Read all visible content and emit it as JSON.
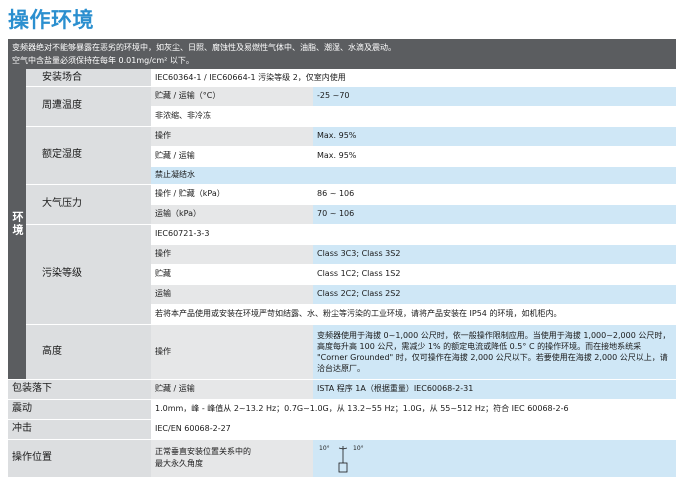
{
  "page": {
    "title": "操作环境",
    "intro_line1": "变频器绝对不能够暴露在恶劣的环境中，如灰尘、日照、腐蚀性及易燃性气体中、油脂、潮湿、水滴及震动。",
    "intro_line2": "空气中含盐量必须保持在每年 0.01mg/cm² 以下。"
  },
  "env_label": "环境",
  "rows": {
    "install_site": {
      "label": "安装场合",
      "value": "IEC60364-1 / IEC60664-1 污染等级 2，仅室内使用"
    },
    "ambient_temp": {
      "label": "周遭温度",
      "storage_transport": "贮藏 / 运输（°C）",
      "storage_value": "-25 ~70",
      "note": "非浓缩、非冷冻"
    },
    "rated_humidity": {
      "label": "额定湿度",
      "operation": "操作",
      "operation_value": "Max. 95%",
      "storage_transport": "贮藏 / 运输",
      "storage_value": "Max. 95%",
      "note": "禁止凝结水"
    },
    "pressure": {
      "label": "大气压力",
      "op_storage": "操作 / 贮藏（kPa）",
      "op_storage_value": "86 ~ 106",
      "transport": "运输（kPa）",
      "transport_value": "70 ~ 106"
    },
    "pollution": {
      "label": "污染等级",
      "standard": "IEC60721-3-3",
      "operation": "操作",
      "operation_value": "Class 3C3; Class 3S2",
      "storage": "贮藏",
      "storage_value": "Class 1C2; Class 1S2",
      "transport": "运输",
      "transport_value": "Class 2C2; Class 2S2",
      "note": "若将本产品使用或安装在环境严苛如结露、水、粉尘等污染的工业环境，请将产品安装在 IP54 的环境，如机柜内。"
    },
    "altitude": {
      "label": "高度",
      "operation": "操作",
      "value": "变频器使用于海拔 0~1,000 公尺时，依一般操作限制应用。当使用于海拔 1,000~2,000 公尺时，高度每升高 100 公尺，需减少 1% 的额定电流或降低 0.5° C 的操作环境。而在接地系统采 \"Corner Grounded\" 时，仅可操作在海拔 2,000 公尺以下。若要使用在海拔 2,000 公尺以上，请洽台达原厂。"
    },
    "packing_drop": {
      "label": "包装落下",
      "sub": "贮藏 / 运输",
      "value": "ISTA 程序 1A（根据重量）IEC60068-2-31"
    },
    "vibration": {
      "label": "震动",
      "value": "1.0mm，峰 - 峰值从 2~13.2 Hz；0.7G~1.0G，从 13.2~55 Hz；1.0G，从 55~512 Hz；符合 IEC 60068-2-6"
    },
    "impact": {
      "label": "冲击",
      "value": "IEC/EN 60068-2-27"
    },
    "position": {
      "label": "操作位置",
      "sub_line1": "正常垂直安装位置关系中的",
      "sub_line2": "最大永久角度",
      "angle_left": "10°",
      "angle_right": "10°"
    }
  }
}
